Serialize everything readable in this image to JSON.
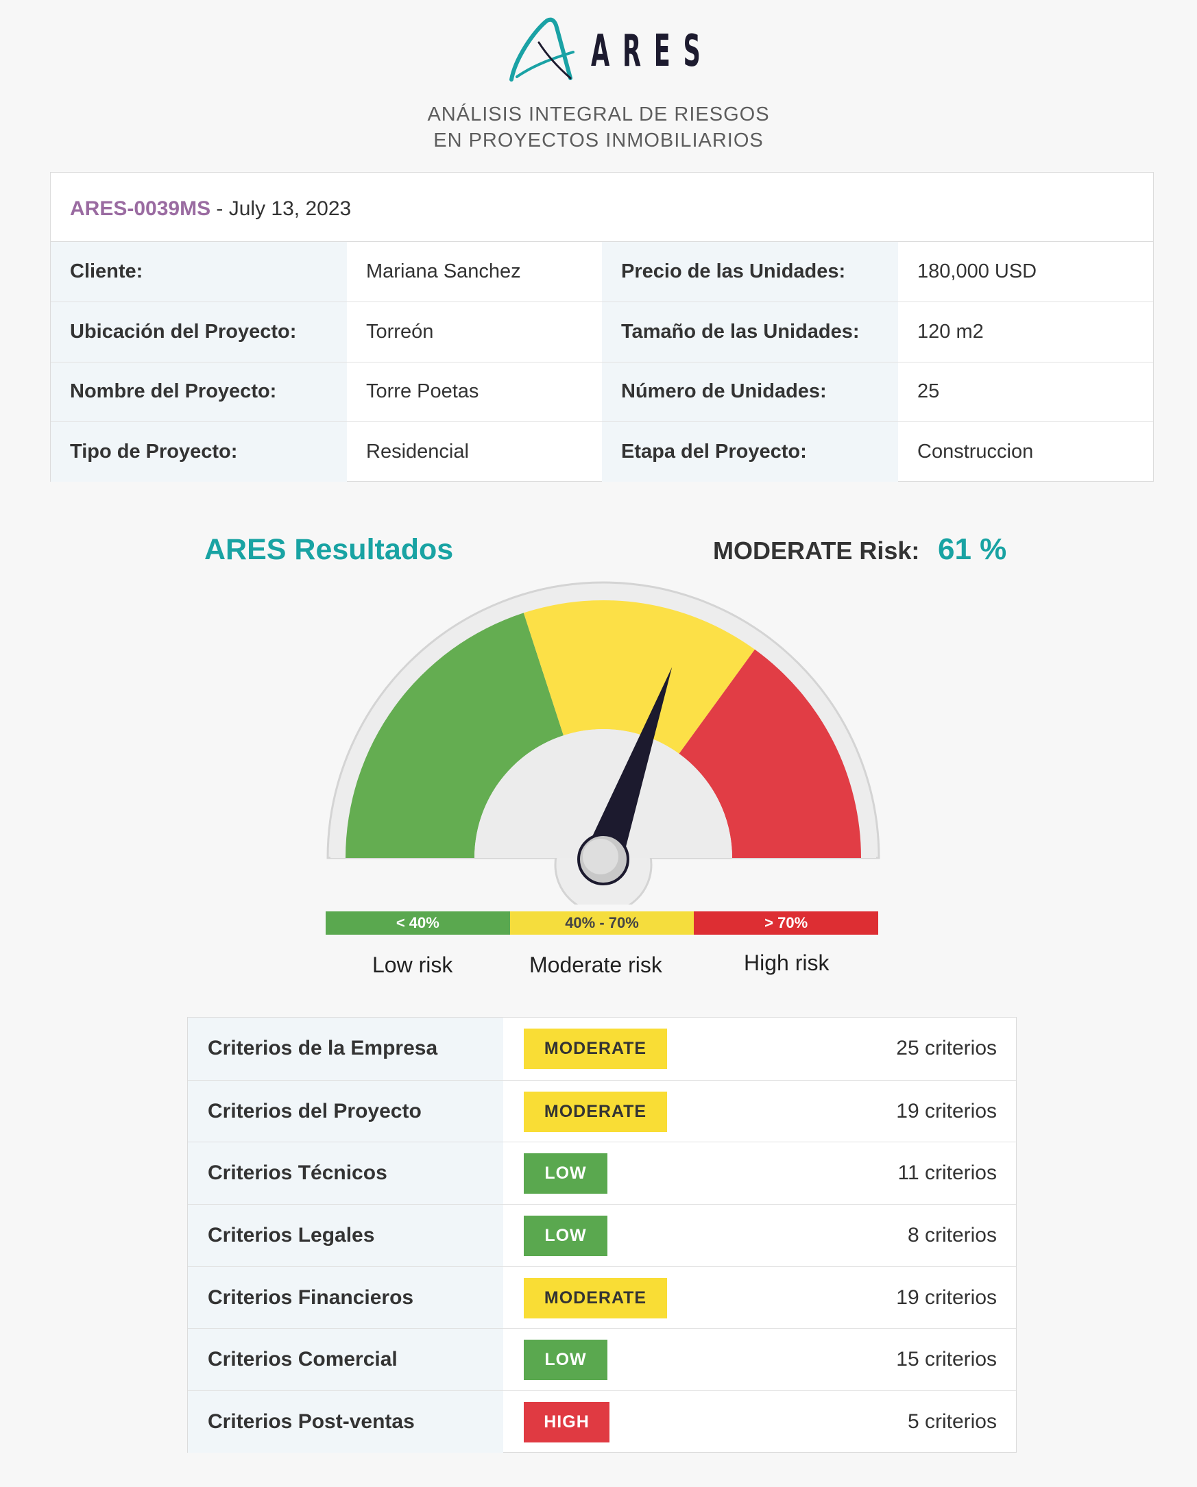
{
  "brand": {
    "name": "ARES",
    "subtitle_line1": "ANÁLISIS INTEGRAL DE RIESGOS",
    "subtitle_line2": "EN PROYECTOS INMOBILIARIOS",
    "accent_color": "#19a3a3"
  },
  "report": {
    "id": "ARES-0039MS",
    "date_text": " - July 13, 2023",
    "rows": [
      {
        "label1": "Cliente:",
        "value1": "Mariana Sanchez",
        "label2": "Precio de las Unidades:",
        "value2": "180,000 USD"
      },
      {
        "label1": "Ubicación del Proyecto:",
        "value1": "Torreón",
        "label2": "Tamaño de las Unidades:",
        "value2": "120 m2"
      },
      {
        "label1": "Nombre del Proyecto:",
        "value1": "Torre Poetas",
        "label2": "Número de Unidades:",
        "value2": "25"
      },
      {
        "label1": "Tipo de Proyecto:",
        "value1": "Residencial",
        "label2": "Etapa del Proyecto:",
        "value2": "Construccion"
      }
    ]
  },
  "results": {
    "title": "ARES Resultados",
    "risk_label": "MODERATE Risk:",
    "risk_value": "61 %",
    "gauge_percent": 61,
    "gauge_colors": {
      "low": "#64ad51",
      "moderate": "#fce047",
      "high": "#e13d45",
      "needle": "#1c1a2e"
    }
  },
  "scale": {
    "low_range": "< 40%",
    "moderate_range": "40% - 70%",
    "high_range": "> 70%",
    "low_name": "Low risk",
    "moderate_name": "Moderate risk",
    "high_name": "High risk"
  },
  "criteria": [
    {
      "name": "Criterios de la Empresa",
      "level": "MODERATE",
      "count": "25 criterios"
    },
    {
      "name": "Criterios del Proyecto",
      "level": "MODERATE",
      "count": "19 criterios"
    },
    {
      "name": "Criterios Técnicos",
      "level": "LOW",
      "count": "11 criterios"
    },
    {
      "name": "Criterios Legales",
      "level": "LOW",
      "count": "8 criterios"
    },
    {
      "name": "Criterios Financieros",
      "level": "MODERATE",
      "count": "19 criterios"
    },
    {
      "name": "Criterios Comercial",
      "level": "LOW",
      "count": "15 criterios"
    },
    {
      "name": "Criterios Post-ventas",
      "level": "HIGH",
      "count": "5 criterios"
    }
  ]
}
